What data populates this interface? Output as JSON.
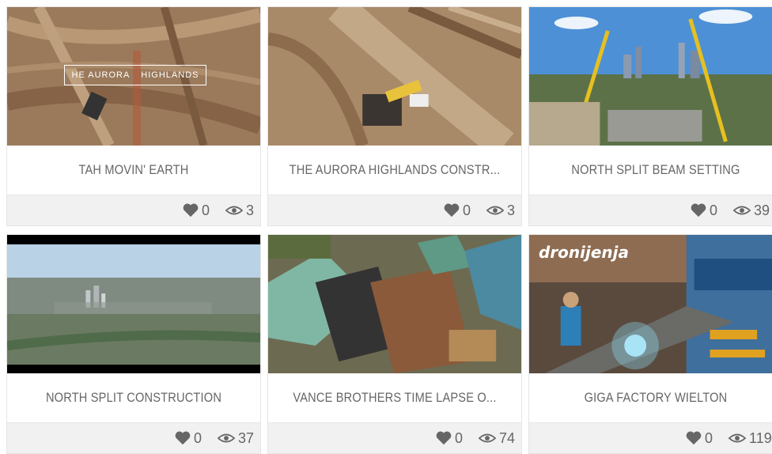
{
  "videos": [
    {
      "title": "TAH MOVIN' EARTH",
      "likes": "0",
      "views": "3",
      "overlay": [
        "HE AURORA",
        "HIGHLANDS"
      ]
    },
    {
      "title": "THE AURORA HIGHLANDS CONSTR...",
      "likes": "0",
      "views": "3"
    },
    {
      "title": "NORTH SPLIT BEAM SETTING",
      "likes": "0",
      "views": "39"
    },
    {
      "title": "NORTH SPLIT CONSTRUCTION",
      "likes": "0",
      "views": "37"
    },
    {
      "title": "VANCE BROTHERS TIME LAPSE O...",
      "likes": "0",
      "views": "74"
    },
    {
      "title": "GIGA FACTORY WIELTON",
      "likes": "0",
      "views": "119",
      "logo": "dronijenja"
    }
  ],
  "colors": {
    "text": "#666666",
    "stats_bg": "#f1f1f1",
    "border": "#e5e5e5"
  },
  "icons": {
    "like": "heart-icon",
    "views": "eye-icon"
  }
}
